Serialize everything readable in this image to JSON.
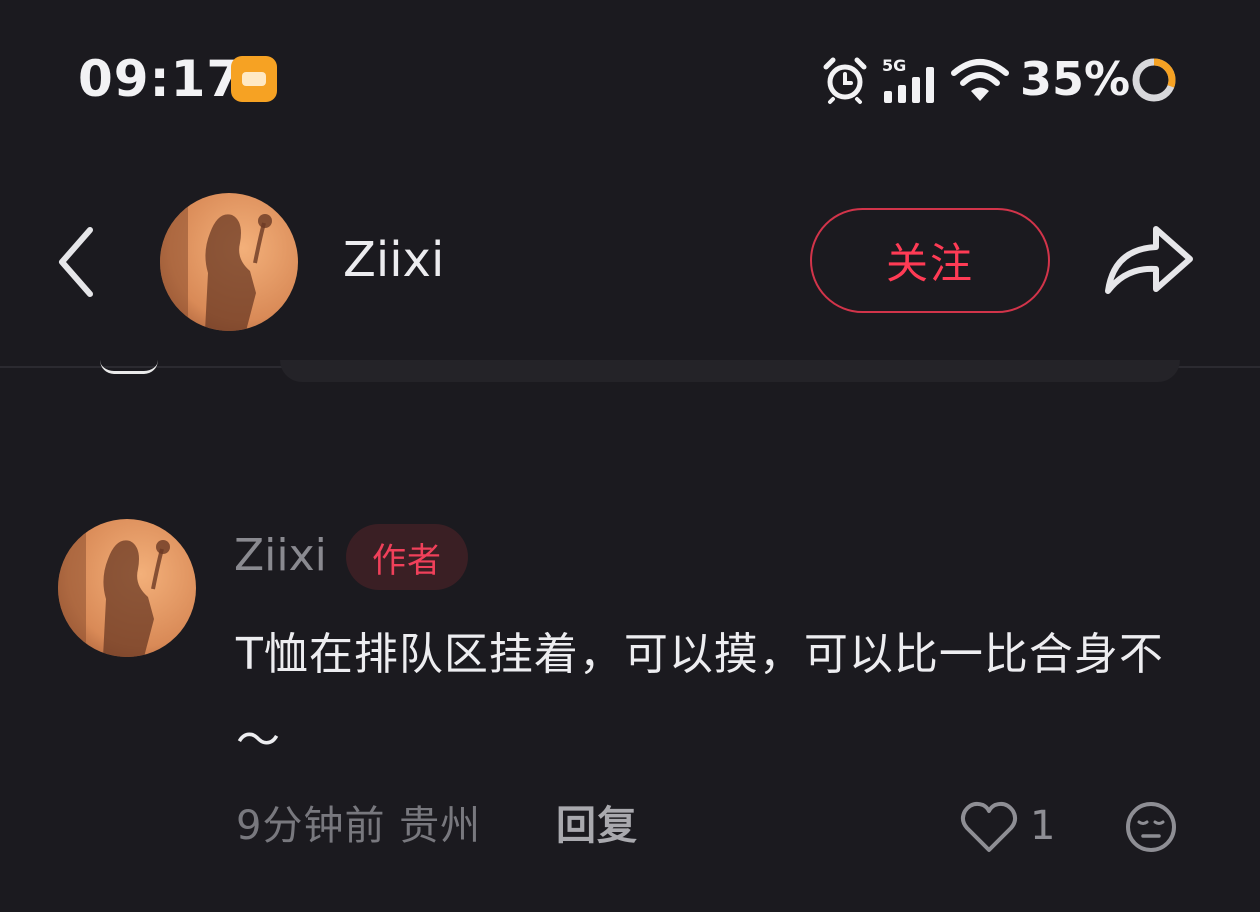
{
  "status_bar": {
    "time": "09:17",
    "network": "5G",
    "battery": "35%",
    "icons": [
      "app-notification-icon",
      "alarm-icon",
      "signal-icon",
      "wifi-icon",
      "battery-ring-icon"
    ],
    "battery_color": "#f6a223"
  },
  "header": {
    "back_icon": "chevron-left-icon",
    "username": "Ziixi",
    "follow_label": "关注",
    "share_icon": "share-arrow-icon"
  },
  "comment": {
    "author": "Ziixi",
    "badge": "作者",
    "text": "T恤在排队区挂着，可以摸，可以比一比合身不～",
    "time": "9分钟前",
    "location": "贵州",
    "meta": "9分钟前 贵州",
    "reply_label": "回复",
    "like_count": "1",
    "like_icon": "heart-outline-icon",
    "emoji_icon": "emoji-face-icon"
  },
  "colors": {
    "background": "#1b1a1f",
    "accent": "#ff3b55",
    "badge_bg": "#3a1f24"
  }
}
